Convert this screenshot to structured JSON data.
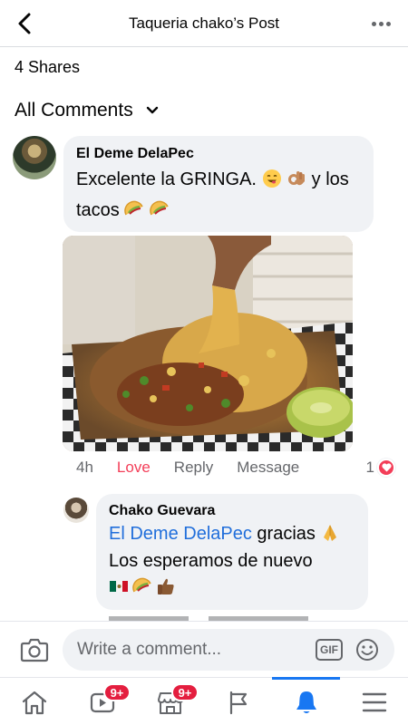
{
  "header": {
    "title": "Taqueria chako’s Post"
  },
  "post": {
    "shares": "4 Shares"
  },
  "comments_section": {
    "filter_label": "All Comments"
  },
  "comment": {
    "author": "El Deme DelaPec",
    "text_part1": "Excelente la GRINGA.",
    "text_part2": "y los",
    "text_part3": "tacos",
    "emojis": [
      "smiling-face-icon",
      "ok-hand-icon",
      "taco-icon",
      "taco-icon"
    ],
    "time": "4h",
    "reaction_label": "Love",
    "reply_label": "Reply",
    "message_label": "Message",
    "reaction_count": "1"
  },
  "reply": {
    "author": "Chako Guevara",
    "mention": "El Deme DelaPec",
    "text_part1": "gracias",
    "text_part2": "Los esperamos de nuevo",
    "emojis": [
      "mexico-flag-icon",
      "taco-icon",
      "thumbs-up-icon"
    ]
  },
  "composer": {
    "placeholder": "Write a comment...",
    "gif_label": "GIF"
  },
  "tabbar": {
    "video_badge": "9+",
    "marketplace_badge": "9+",
    "active_tab": "notifications"
  },
  "colors": {
    "accent": "#1877f2",
    "love": "#f33e58",
    "mention": "#216fdb",
    "bubble": "#f0f2f5",
    "badge": "#e41e3f"
  }
}
